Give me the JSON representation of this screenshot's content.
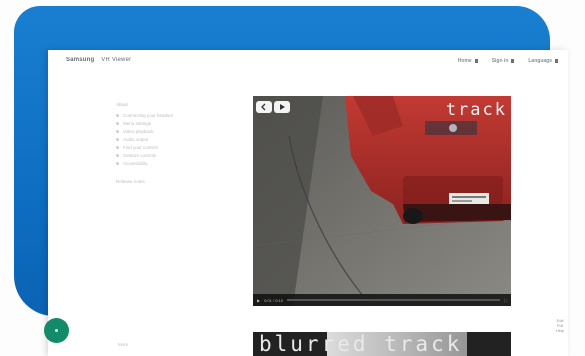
{
  "header": {
    "brand": "Samsung",
    "brand_sub": "VR Viewer",
    "nav": [
      "Home",
      "Sign in",
      "Language"
    ]
  },
  "sidebar": {
    "heading": "About",
    "items": [
      "Connecting your headset",
      "Menu settings",
      "Video playback",
      "Audio output",
      "Find your content",
      "Gesture controls",
      "Accessibility"
    ],
    "footer": "Release notes"
  },
  "player": {
    "overlay_text": "track",
    "time": "0:01 / 0:10",
    "buttons": [
      "back",
      "play"
    ]
  },
  "thumbnail": {
    "text": "blurred track"
  },
  "corner_tools": [
    "Edit",
    "Full",
    "Help"
  ],
  "bottom_left": "More",
  "colors": {
    "frame_blue": "#1a7fd0",
    "fab_green": "#138a6a",
    "car_red": "#b22a28"
  }
}
